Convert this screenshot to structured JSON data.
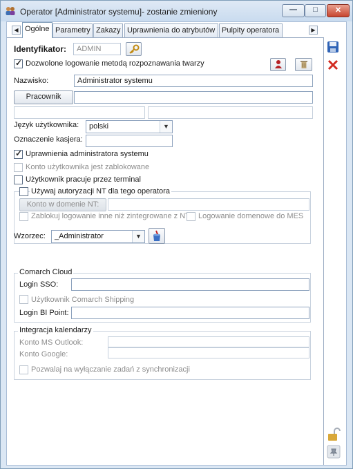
{
  "window": {
    "title": "Operator [Administrator systemu]- zostanie zmieniony"
  },
  "tabs": [
    "Ogólne",
    "Parametry",
    "Zakazy",
    "Uprawnienia do atrybutów",
    "Pulpity operatora"
  ],
  "form": {
    "identyfikator_label": "Identyfikator:",
    "identyfikator_value": "ADMIN",
    "face_login_label": "Dozwolone logowanie metodą rozpoznawania twarzy",
    "face_login_checked": true,
    "nazwisko_label": "Nazwisko:",
    "nazwisko_value": "Administrator systemu",
    "pracownik_button": "Pracownik",
    "jezyk_label": "Język użytkownika:",
    "jezyk_value": "polski",
    "kasjer_label": "Oznaczenie kasjera:",
    "uprawnienia_admin_label": "Uprawnienia administratora systemu",
    "uprawnienia_admin_checked": true,
    "konto_zablokowane_label": "Konto użytkownika jest zablokowane",
    "terminal_label": "Użytkownik pracuje przez terminal",
    "nt_label": "Używaj autoryzacji NT dla tego operatora",
    "konto_domenie_button": "Konto w domenie NT:",
    "zablokuj_label": "Zablokuj logowanie inne niż zintegrowane z NT",
    "logowanie_mes_label": "Logowanie domenowe do MES",
    "wzorzec_label": "Wzorzec:",
    "wzorzec_value": "_Administrator"
  },
  "cloud": {
    "title": "Comarch Cloud",
    "login_sso_label": "Login SSO:",
    "shipping_label": "Użytkownik Comarch Shipping",
    "login_bi_label": "Login BI Point:"
  },
  "calendar": {
    "title": "Integracja kalendarzy",
    "outlook_label": "Konto MS Outlook:",
    "google_label": "Konto Google:",
    "sync_label": "Pozwalaj na wyłączanie zadań z synchronizacji"
  },
  "colors": {
    "accent": "#2a63b8",
    "close": "#c7452f",
    "disabled_text": "#8c8c8c"
  }
}
